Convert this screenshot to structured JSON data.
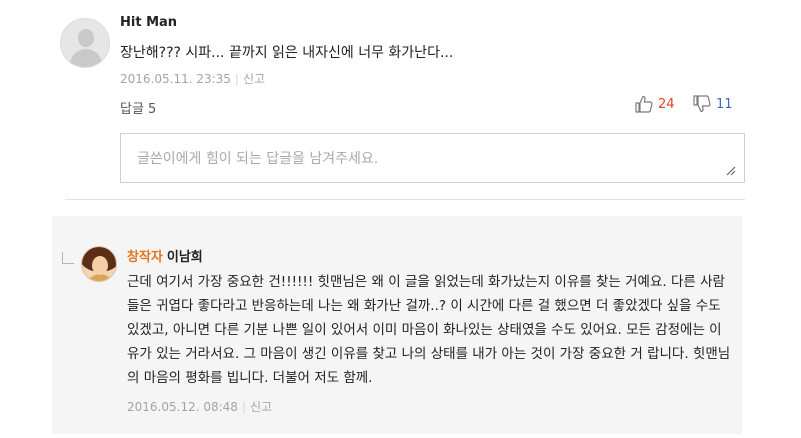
{
  "comment": {
    "author": "Hit Man",
    "avatar_icon": "default-user-icon",
    "text": "장난해??? 시파... 끝까지 읽은 내자신에 너무 화가난다...",
    "date": "2016.05.11. 23:35",
    "report_label": "신고",
    "reply_count_label": "답글 5",
    "likes": "24",
    "dislikes": "11",
    "like_icon": "thumbs-up-icon",
    "dislike_icon": "thumbs-down-icon"
  },
  "reply_input": {
    "placeholder": "글쓴이에게 힘이 되는 답글을 남겨주세요."
  },
  "reply": {
    "badge": "창작자",
    "author": "이남희",
    "avatar_icon": "author-avatar-icon",
    "text": "근데 여기서 가장 중요한 건!!!!!! 힛맨님은 왜 이 글을 읽었는데 화가났는지 이유를 찾는 거예요. 다른 사람들은 귀엽다 좋다라고 반응하는데 나는 왜 화가난 걸까..? 이 시간에 다른 걸 했으면 더 좋았겠다 싶을 수도 있겠고, 아니면 다른 기분 나쁜 일이 있어서 이미 마음이 화나있는 상태였을 수도 있어요. 모든 감정에는 이유가 있는 거라서요. 그 마음이 생긴 이유를 찾고 나의 상태를 내가 아는 것이 가장 중요한 거 랍니다. 힛맨님의 마음의 평화를 빕니다. 더불어 저도 함께.",
    "date": "2016.05.12. 08:48",
    "report_label": "신고"
  },
  "colors": {
    "like": "#e4412c",
    "dislike": "#3d6bbf",
    "creator_badge": "#e2751d",
    "reply_bg": "#f5f5f5"
  }
}
